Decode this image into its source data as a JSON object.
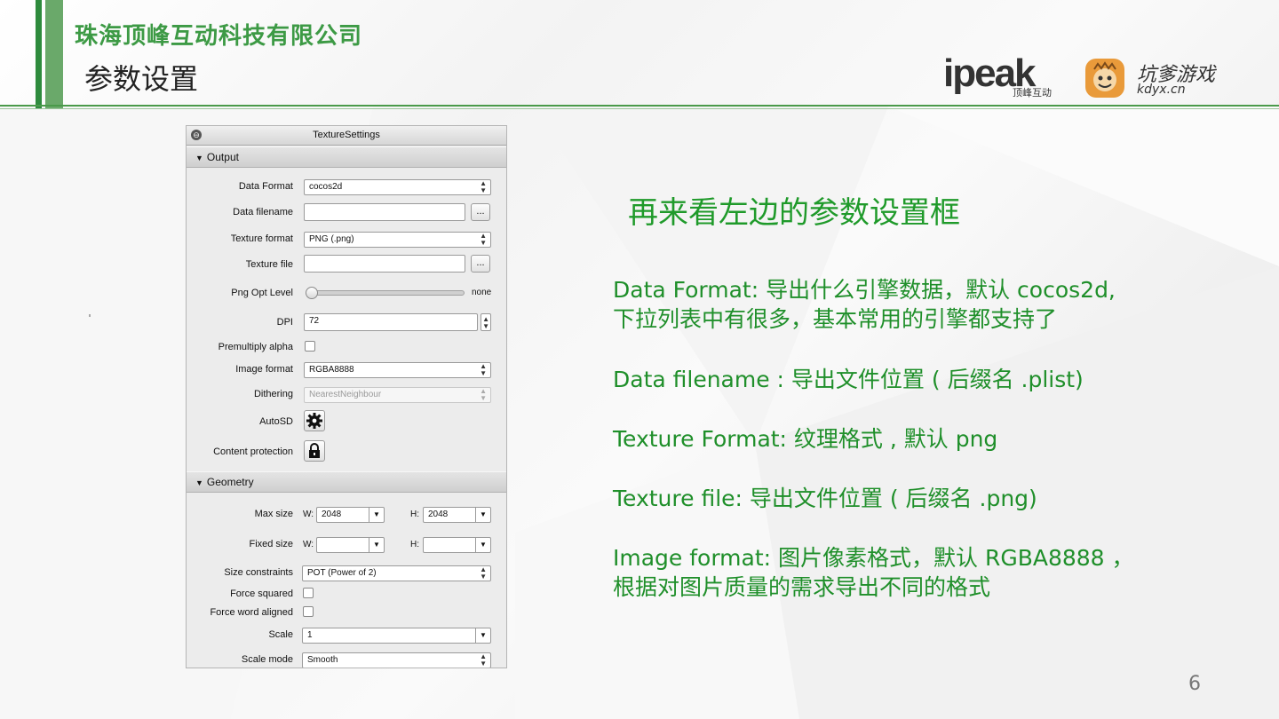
{
  "header": {
    "company": "珠海顶峰互动科技有限公司",
    "page_title": "参数设置",
    "logo_ipeak": {
      "text": "ipeak",
      "subtext": "顶峰互动"
    },
    "logo_kdyx": {
      "name": "坑爹游戏",
      "url": "kdyx.cn"
    }
  },
  "panel": {
    "title": "TextureSettings",
    "output_section": "Output",
    "geometry_section": "Geometry",
    "rows": {
      "data_format": {
        "label": "Data Format",
        "value": "cocos2d"
      },
      "data_filename": {
        "label": "Data filename",
        "value": "",
        "browse": "..."
      },
      "texture_format": {
        "label": "Texture format",
        "value": "PNG (.png)"
      },
      "texture_file": {
        "label": "Texture file",
        "value": "",
        "browse": "..."
      },
      "png_opt_level": {
        "label": "Png Opt Level",
        "value_text": "none",
        "level": 0
      },
      "dpi": {
        "label": "DPI",
        "value": "72"
      },
      "premultiply_alpha": {
        "label": "Premultiply alpha",
        "checked": false
      },
      "image_format": {
        "label": "Image format",
        "value": "RGBA8888"
      },
      "dithering": {
        "label": "Dithering",
        "value": "NearestNeighbour"
      },
      "autosd": {
        "label": "AutoSD",
        "icon": "gear-icon"
      },
      "content_protection": {
        "label": "Content protection",
        "icon": "lock-icon"
      },
      "max_size": {
        "label": "Max size",
        "w_label": "W:",
        "w_value": "2048",
        "h_label": "H:",
        "h_value": "2048"
      },
      "fixed_size": {
        "label": "Fixed size",
        "w_label": "W:",
        "w_value": "",
        "h_label": "H:",
        "h_value": ""
      },
      "size_constraints": {
        "label": "Size constraints",
        "value": "POT (Power of 2)"
      },
      "force_squared": {
        "label": "Force squared",
        "checked": false
      },
      "force_word_aligned": {
        "label": "Force word aligned",
        "checked": false
      },
      "scale": {
        "label": "Scale",
        "value": "1"
      },
      "scale_mode": {
        "label": "Scale mode",
        "value": "Smooth"
      }
    }
  },
  "content": {
    "heading": "再来看左边的参数设置框",
    "items": [
      {
        "line1": " Data Format: 导出什么引擎数据，默认 cocos2d,",
        "line2": "下拉列表中有很多，基本常用的引擎都支持了"
      },
      {
        "line1": "Data filename : 导出文件位置 ( 后缀名 .plist)"
      },
      {
        "line1": "Texture Format: 纹理格式 , 默认 png"
      },
      {
        "line1": "Texture file: 导出文件位置 ( 后缀名 .png)"
      },
      {
        "line1": "Image format: 图片像素格式，默认 RGBA8888 ，",
        "line2": "根据对图片质量的需求导出不同的格式"
      }
    ]
  },
  "page_number": "6",
  "colors": {
    "accent_green": "#1f8f2a",
    "company_green": "#3d9a45",
    "bar_green": "#2e8b3d"
  }
}
